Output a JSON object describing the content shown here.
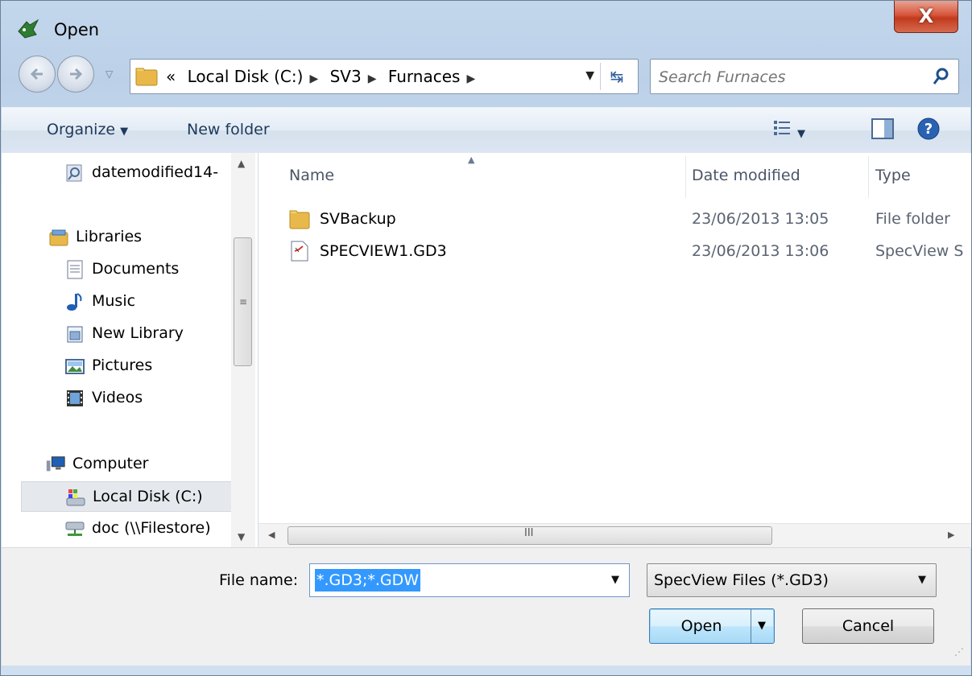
{
  "window": {
    "title": "Open",
    "close_label": "X"
  },
  "navigation": {
    "breadcrumb_overflow": "«",
    "breadcrumbs": [
      "Local Disk (C:)",
      "SV3",
      "Furnaces"
    ],
    "search_placeholder": "Search Furnaces"
  },
  "toolbar": {
    "organize_label": "Organize",
    "new_folder_label": "New folder"
  },
  "nav_pane": {
    "items": [
      {
        "label": "datemodified14-",
        "icon": "search-folder-icon"
      },
      {
        "label": "Libraries",
        "icon": "libraries-icon"
      },
      {
        "label": "Documents",
        "icon": "documents-icon"
      },
      {
        "label": "Music",
        "icon": "music-icon"
      },
      {
        "label": "New Library",
        "icon": "library-icon"
      },
      {
        "label": "Pictures",
        "icon": "pictures-icon"
      },
      {
        "label": "Videos",
        "icon": "videos-icon"
      },
      {
        "label": "Computer",
        "icon": "computer-icon"
      },
      {
        "label": "Local Disk (C:)",
        "icon": "local-disk-icon",
        "selected": true
      },
      {
        "label": "doc (\\\\Filestore)",
        "icon": "network-drive-icon"
      }
    ]
  },
  "file_list": {
    "columns": [
      "Name",
      "Date modified",
      "Type"
    ],
    "rows": [
      {
        "name": "SVBackup",
        "date": "23/06/2013 13:05",
        "type": "File folder",
        "icon": "folder-icon"
      },
      {
        "name": "SPECVIEW1.GD3",
        "date": "23/06/2013 13:06",
        "type": "SpecView S",
        "icon": "specview-file-icon"
      }
    ]
  },
  "bottom": {
    "file_name_label": "File name:",
    "file_name_value": "*.GD3;*.GDW",
    "file_type_value": "SpecView Files (*.GD3)",
    "open_label": "Open",
    "cancel_label": "Cancel"
  },
  "colors": {
    "selection_blue": "#3399ff",
    "close_button_red": "#c13a1f",
    "toolbar_text": "#1e395b"
  }
}
